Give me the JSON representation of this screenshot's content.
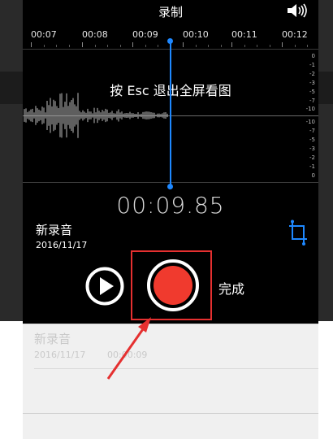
{
  "header": {
    "title": "录制",
    "speaker_icon": "speaker-icon"
  },
  "timeline": {
    "labels": [
      "00:07",
      "00:08",
      "00:09",
      "00:10",
      "00:11",
      "00:12"
    ]
  },
  "scale": {
    "top": [
      "0",
      "-1",
      "-2",
      "-3",
      "-5",
      "-7",
      "-10"
    ],
    "bottom": [
      "-10",
      "-7",
      "-5",
      "-3",
      "-2",
      "-1",
      "0"
    ]
  },
  "overlay": {
    "esc_hint": "按 Esc 退出全屏看图"
  },
  "recording": {
    "timer": "00:09.85",
    "name": "新录音",
    "date": "2016/11/17",
    "done_label": "完成",
    "crop_icon": "crop-icon",
    "play_icon": "play-icon"
  },
  "list": {
    "items": [
      {
        "name": "新录音",
        "date": "2016/11/17",
        "duration": "00:00:09"
      }
    ]
  },
  "colors": {
    "record_red": "#f03a2e",
    "playhead_blue": "#1e88ff",
    "highlight_frame": "#e53030"
  }
}
